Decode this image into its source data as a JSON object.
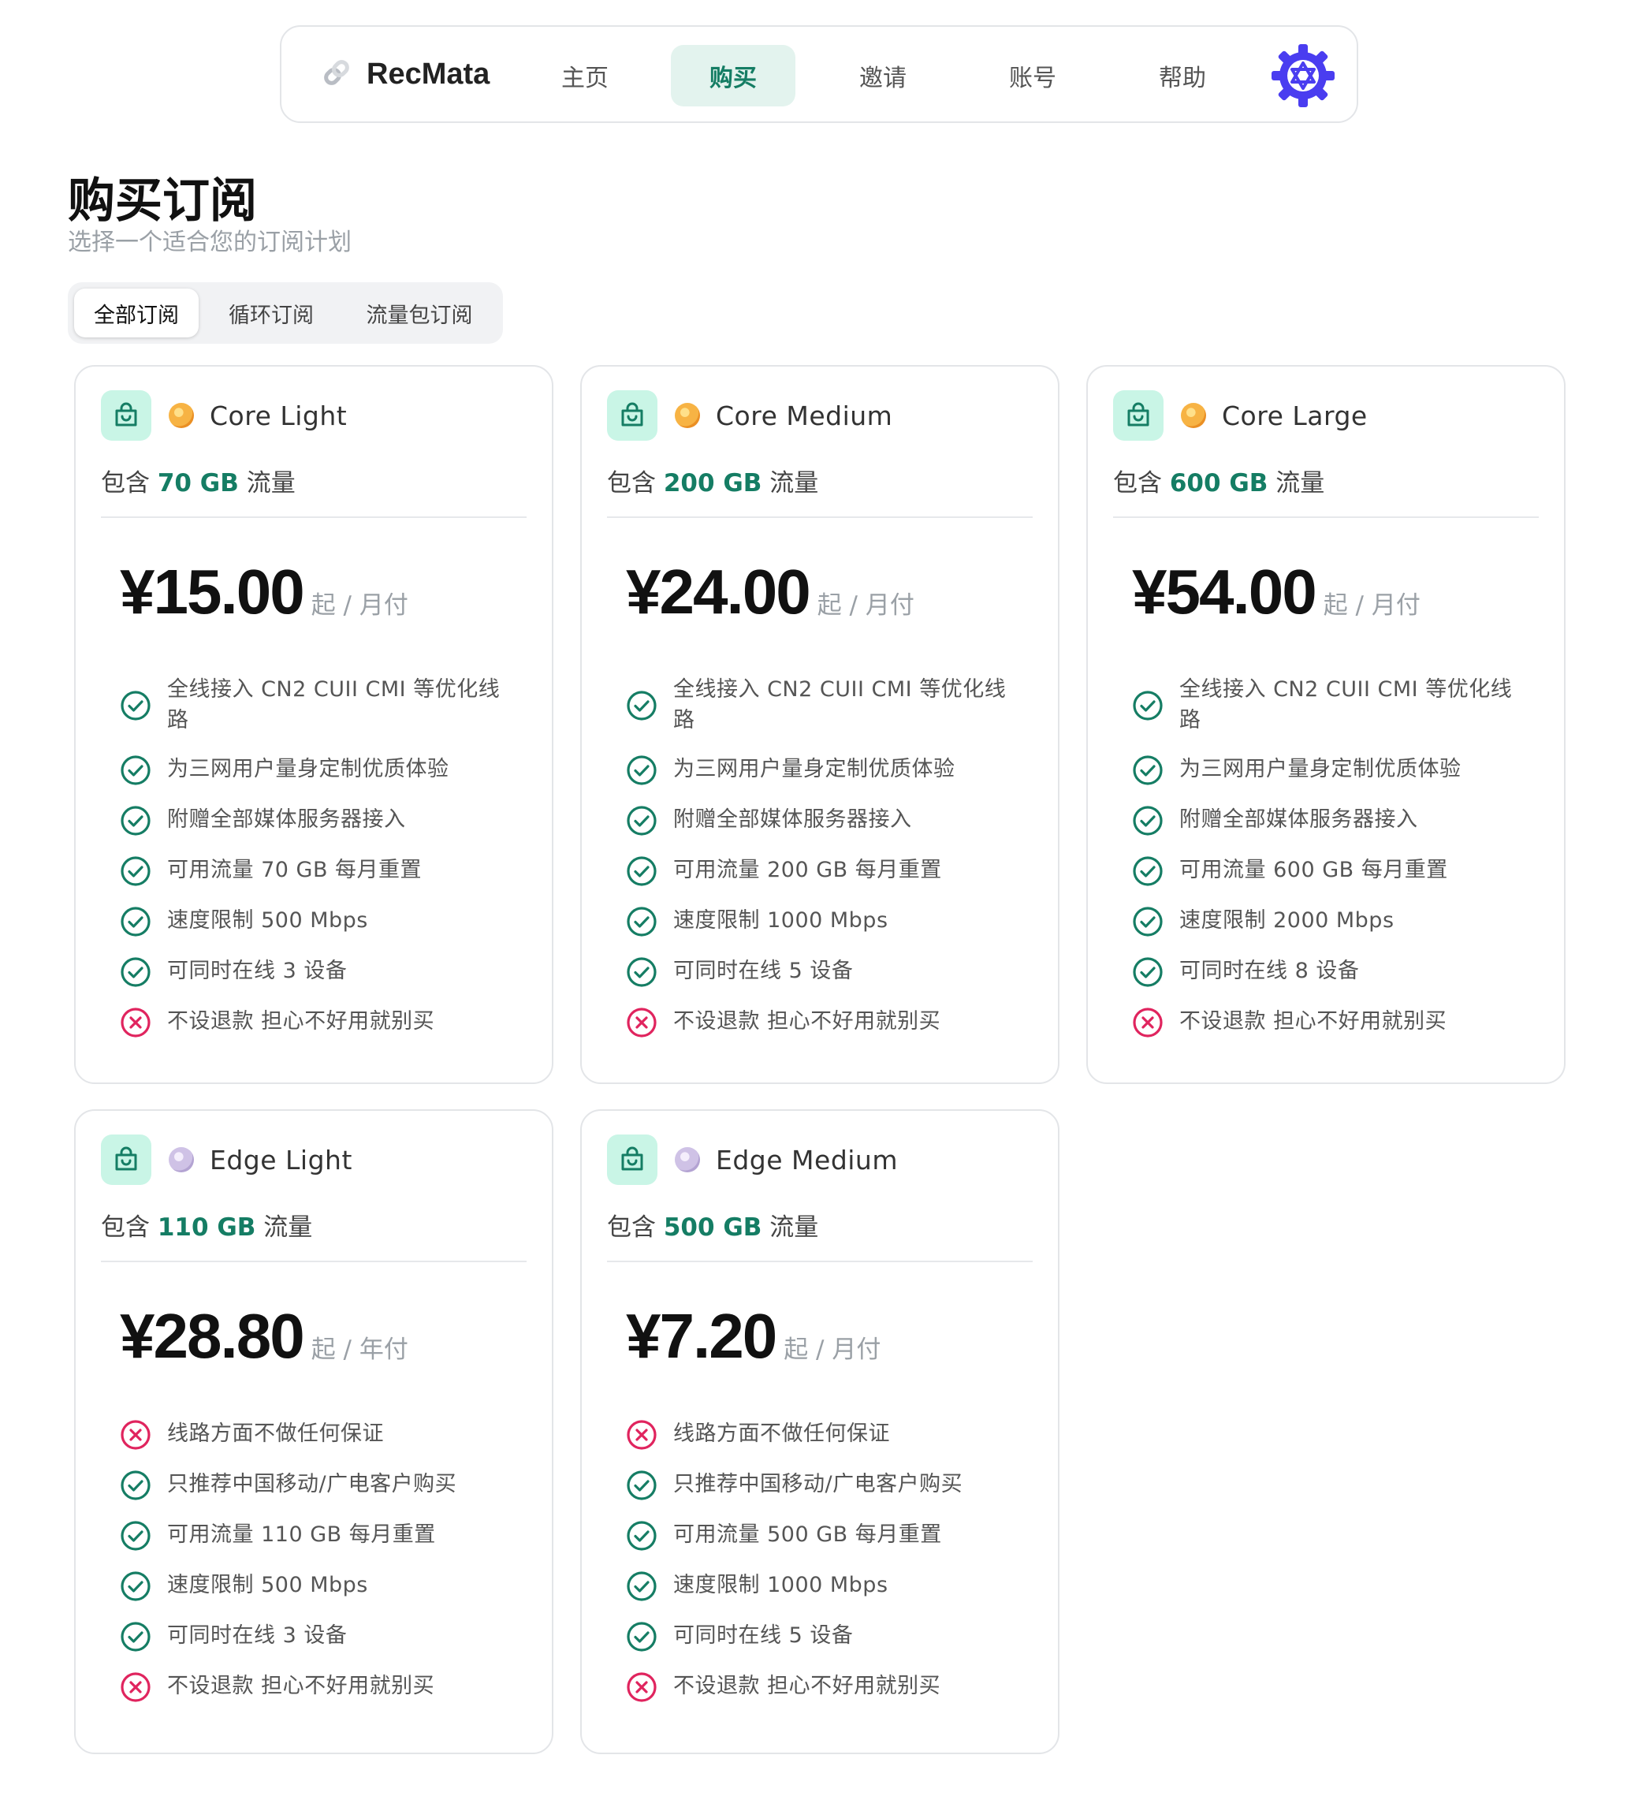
{
  "nav": {
    "brand": "RecMata",
    "items": [
      {
        "label": "主页",
        "active": false
      },
      {
        "label": "购买",
        "active": true
      },
      {
        "label": "邀请",
        "active": false
      },
      {
        "label": "账号",
        "active": false
      },
      {
        "label": "帮助",
        "active": false
      }
    ],
    "brand_color": "#222222",
    "accent_color": "#157d64",
    "gear_color": "#4a3df0"
  },
  "page": {
    "title": "购买订阅",
    "subtitle": "选择一个适合您的订阅计划"
  },
  "filters": [
    {
      "label": "全部订阅",
      "active": true
    },
    {
      "label": "循环订阅",
      "active": false
    },
    {
      "label": "流量包订阅",
      "active": false
    }
  ],
  "plans": [
    {
      "name": "Core Light",
      "coin": "gold-coin-icon",
      "traffic_prefix": "包含",
      "traffic_amount": "70 GB",
      "traffic_suffix": "流量",
      "price": "¥15.00",
      "price_unit": "起 / 月付",
      "features": [
        {
          "text": "全线接入 CN2 CUII CMI 等优化线路",
          "ok": true
        },
        {
          "text": "为三网用户量身定制优质体验",
          "ok": true
        },
        {
          "text": "附赠全部媒体服务器接入",
          "ok": true
        },
        {
          "text": "可用流量 70 GB 每月重置",
          "ok": true
        },
        {
          "text": "速度限制 500 Mbps",
          "ok": true
        },
        {
          "text": "可同时在线 3 设备",
          "ok": true
        },
        {
          "text": "不设退款 担心不好用就别买",
          "ok": false
        }
      ]
    },
    {
      "name": "Core Medium",
      "coin": "gold-coin-icon",
      "traffic_prefix": "包含",
      "traffic_amount": "200 GB",
      "traffic_suffix": "流量",
      "price": "¥24.00",
      "price_unit": "起 / 月付",
      "features": [
        {
          "text": "全线接入 CN2 CUII CMI 等优化线路",
          "ok": true
        },
        {
          "text": "为三网用户量身定制优质体验",
          "ok": true
        },
        {
          "text": "附赠全部媒体服务器接入",
          "ok": true
        },
        {
          "text": "可用流量 200 GB 每月重置",
          "ok": true
        },
        {
          "text": "速度限制 1000 Mbps",
          "ok": true
        },
        {
          "text": "可同时在线 5 设备",
          "ok": true
        },
        {
          "text": "不设退款 担心不好用就别买",
          "ok": false
        }
      ]
    },
    {
      "name": "Core Large",
      "coin": "gold-coin-icon",
      "traffic_prefix": "包含",
      "traffic_amount": "600 GB",
      "traffic_suffix": "流量",
      "price": "¥54.00",
      "price_unit": "起 / 月付",
      "features": [
        {
          "text": "全线接入 CN2 CUII CMI 等优化线路",
          "ok": true
        },
        {
          "text": "为三网用户量身定制优质体验",
          "ok": true
        },
        {
          "text": "附赠全部媒体服务器接入",
          "ok": true
        },
        {
          "text": "可用流量 600 GB 每月重置",
          "ok": true
        },
        {
          "text": "速度限制 2000 Mbps",
          "ok": true
        },
        {
          "text": "可同时在线 8 设备",
          "ok": true
        },
        {
          "text": "不设退款 担心不好用就别买",
          "ok": false
        }
      ]
    },
    {
      "name": "Edge Light",
      "coin": "silver-coin-icon",
      "traffic_prefix": "包含",
      "traffic_amount": "110 GB",
      "traffic_suffix": "流量",
      "price": "¥28.80",
      "price_unit": "起 / 年付",
      "features": [
        {
          "text": "线路方面不做任何保证",
          "ok": false
        },
        {
          "text": "只推荐中国移动/广电客户购买",
          "ok": true
        },
        {
          "text": "可用流量 110 GB 每月重置",
          "ok": true
        },
        {
          "text": "速度限制 500 Mbps",
          "ok": true
        },
        {
          "text": "可同时在线 3 设备",
          "ok": true
        },
        {
          "text": "不设退款 担心不好用就别买",
          "ok": false
        }
      ]
    },
    {
      "name": "Edge Medium",
      "coin": "silver-coin-icon",
      "traffic_prefix": "包含",
      "traffic_amount": "500 GB",
      "traffic_suffix": "流量",
      "price": "¥7.20",
      "price_unit": "起 / 月付",
      "features": [
        {
          "text": "线路方面不做任何保证",
          "ok": false
        },
        {
          "text": "只推荐中国移动/广电客户购买",
          "ok": true
        },
        {
          "text": "可用流量 500 GB 每月重置",
          "ok": true
        },
        {
          "text": "速度限制 1000 Mbps",
          "ok": true
        },
        {
          "text": "可同时在线 5 设备",
          "ok": true
        },
        {
          "text": "不设退款 担心不好用就别买",
          "ok": false
        }
      ]
    }
  ],
  "colors": {
    "check": "#157d64",
    "cross": "#e0245e",
    "bag_bg": "#c9f5e6"
  }
}
